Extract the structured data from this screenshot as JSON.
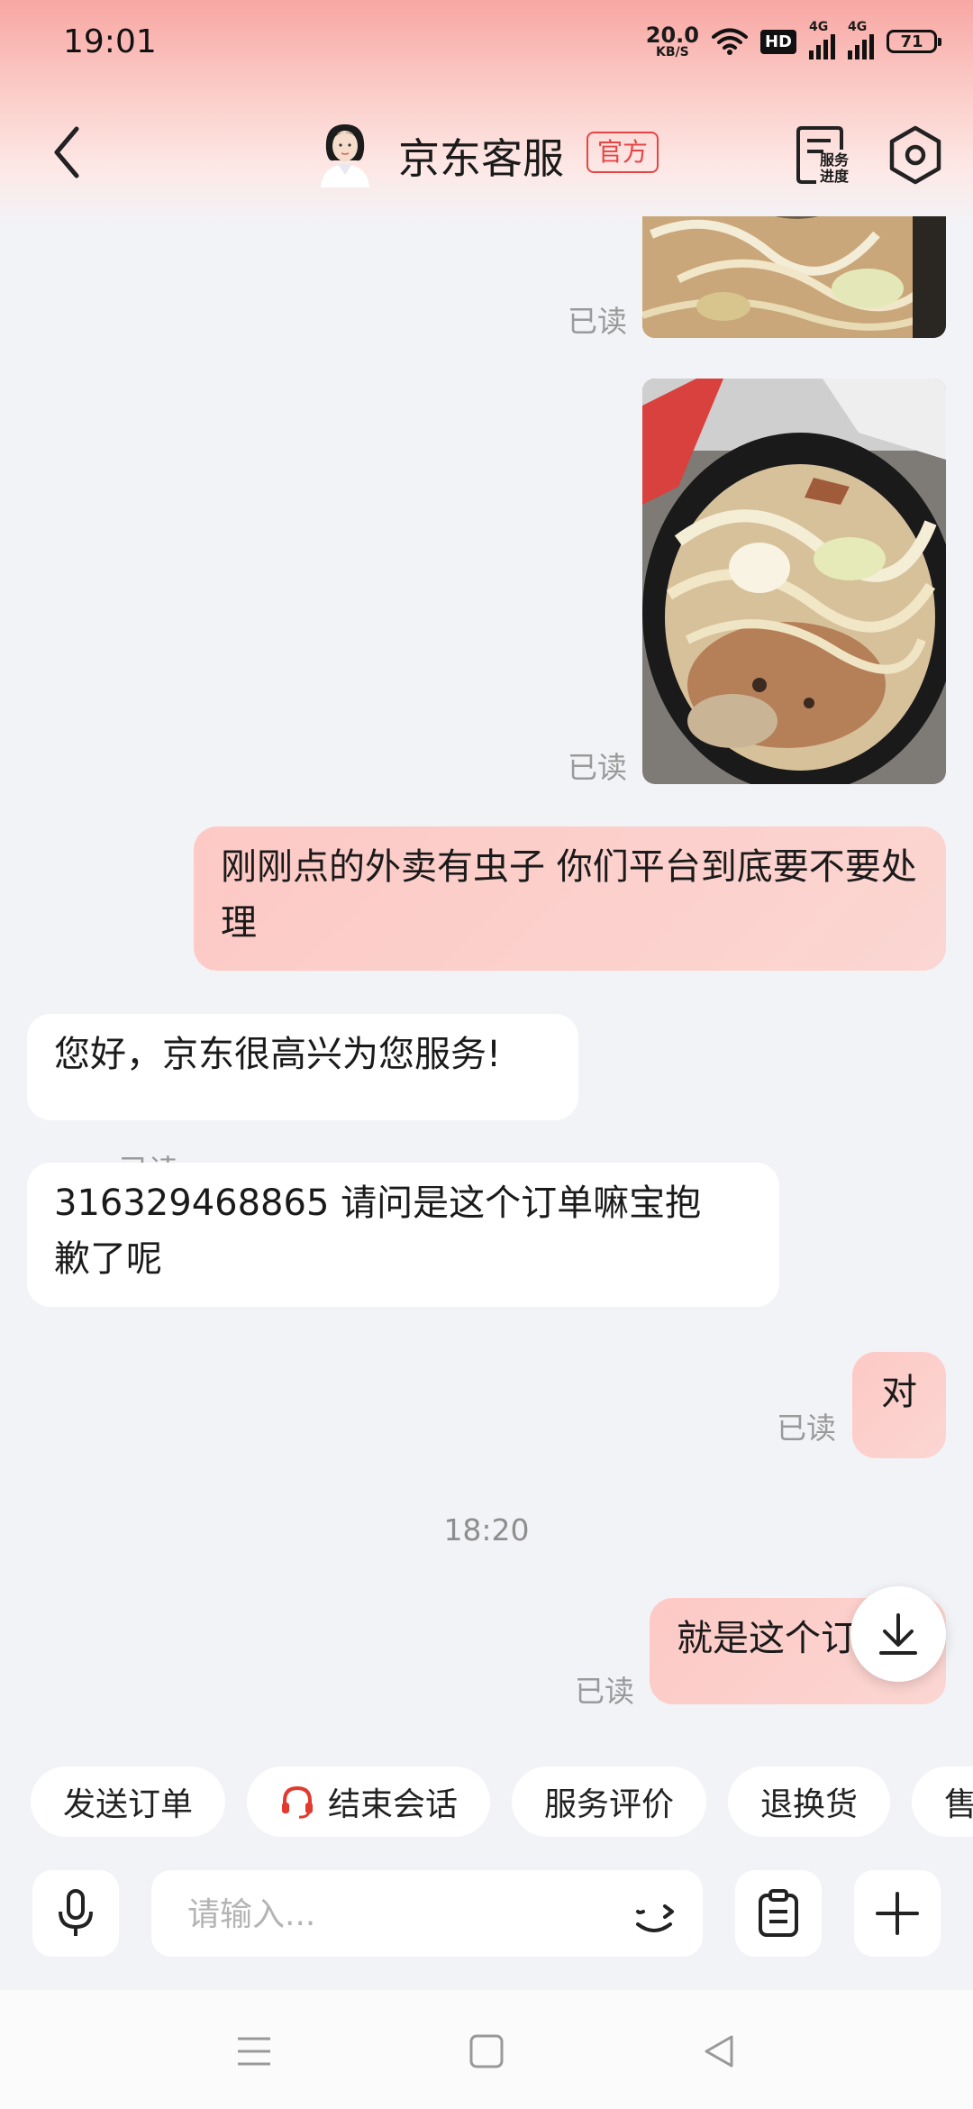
{
  "status_bar": {
    "time": "19:01",
    "net_speed_value": "20.0",
    "net_speed_unit": "KB/S",
    "hd_label": "HD",
    "sim1_label": "4G",
    "sim2_label": "4G",
    "battery": "71"
  },
  "header": {
    "title": "京东客服",
    "badge": "官方",
    "service_progress_line1": "服务",
    "service_progress_line2": "进度"
  },
  "messages": {
    "read_label": "已读",
    "msg1_text": "刚刚点的外卖有虫子 你们平台到底要不要处理",
    "reply1_text": "您好，京东很高兴为您服务!",
    "reply2_text": "316329468865  请问是这个订单嘛宝抱歉了呢",
    "msg2_text": "对",
    "timestamp": "18:20",
    "msg3_text": "就是这个订"
  },
  "quick_actions": [
    "发送订单",
    "结束会话",
    "服务评价",
    "退换货",
    "售"
  ],
  "input": {
    "placeholder": "请输入..."
  },
  "colors": {
    "accent": "#e64545",
    "bubble_sent": "#fdc9c5",
    "background": "#f2f3f7"
  }
}
